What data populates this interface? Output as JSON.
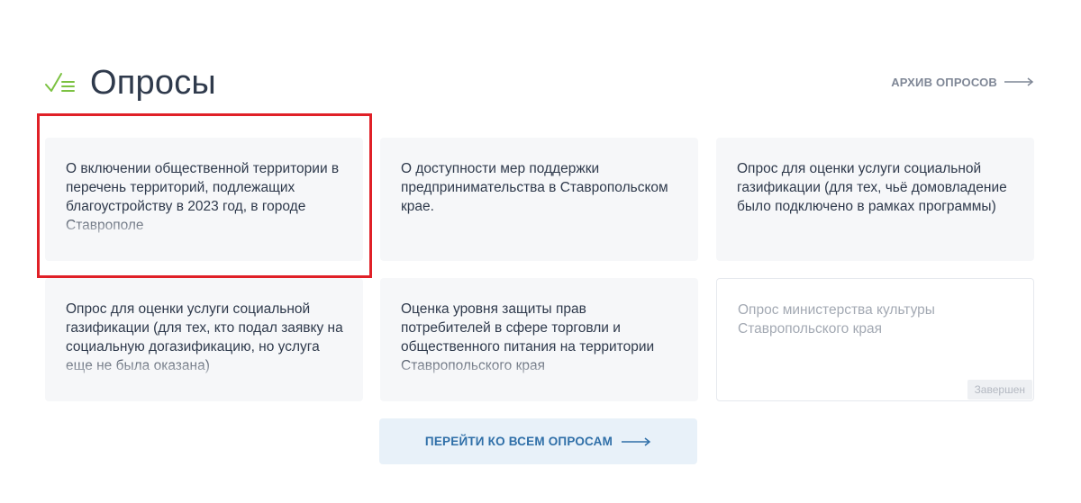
{
  "header": {
    "title": "Опросы",
    "icon": "checklist-icon",
    "archive_link": "АРХИВ ОПРОСОВ"
  },
  "polls": [
    {
      "title": "О включении общественной территории в перечень территорий, подлежащих благоустройству в 2023 год, в городе Ставрополе"
    },
    {
      "title": "О доступности мер поддержки предпринимательства в Ставропольском крае."
    },
    {
      "title": "Опрос для оценки услуги социальной газификации (для тех, чьё домовладение было подключено в рамках программы)"
    },
    {
      "title": "Опрос для оценки услуги социальной газификации (для тех, кто подал заявку на социальную догазификацию, но услуга еще не была оказана)"
    },
    {
      "title": "Оценка уровня защиты прав потребителей в сфере торговли и общественного питания на территории Ставропольского края"
    },
    {
      "title": "Опрос министерства культуры Ставропольского края",
      "status": "Завершен"
    }
  ],
  "footer": {
    "all_polls_button": "ПЕРЕЙТИ КО ВСЕМ ОПРОСАМ"
  },
  "colors": {
    "icon_green": "#7cc242",
    "highlight_red": "#e02027",
    "button_bg": "#e8f1f9",
    "button_text": "#2f6fa8",
    "card_bg": "#f6f7f9"
  }
}
